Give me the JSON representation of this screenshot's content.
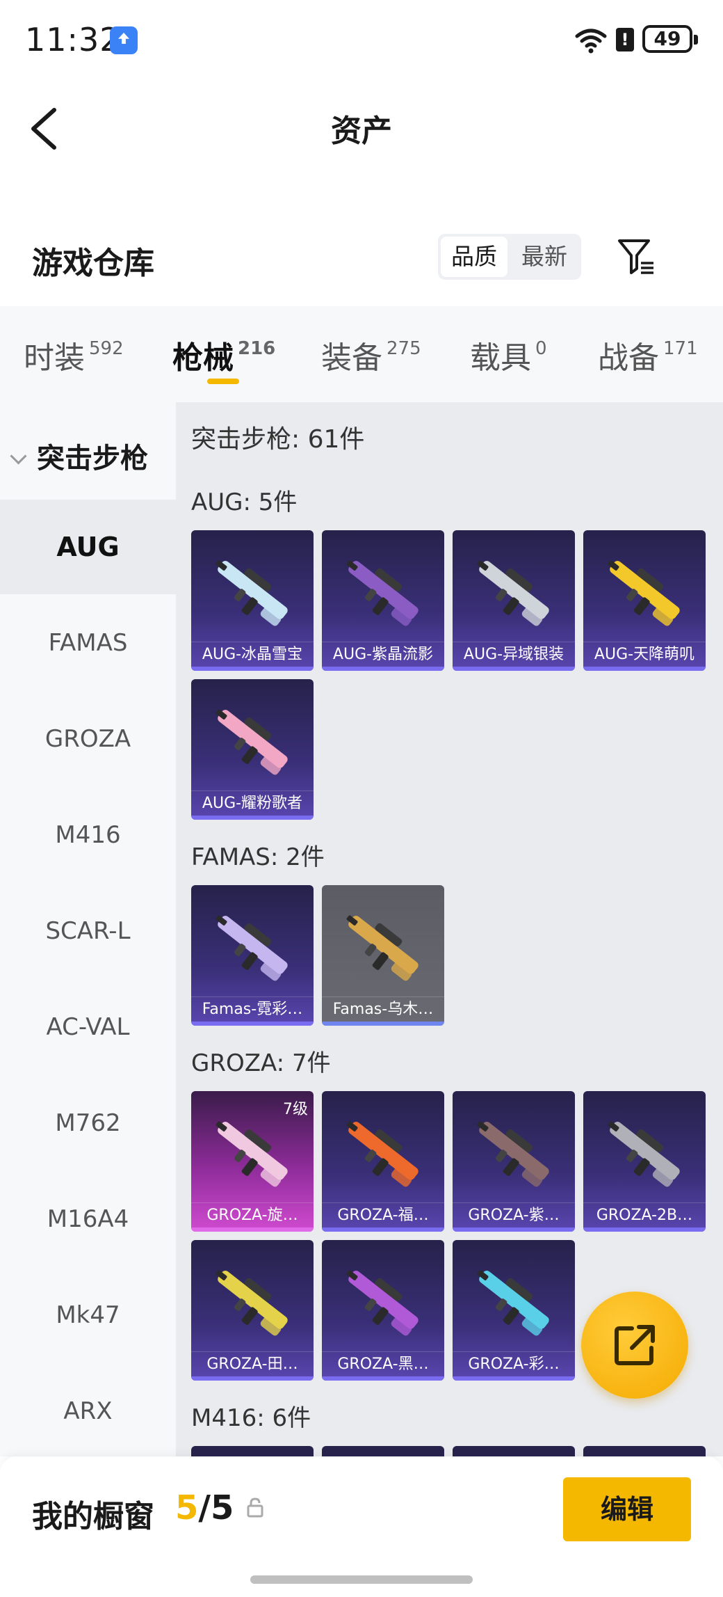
{
  "status_bar": {
    "time": "11:32",
    "battery": "49"
  },
  "header": {
    "title": "资产"
  },
  "warehouse": {
    "title": "游戏仓库",
    "sort_options": [
      "品质",
      "最新"
    ],
    "active_sort": "品质"
  },
  "tabs": [
    {
      "label": "时装",
      "count": "592"
    },
    {
      "label": "枪械",
      "count": "216",
      "active": true
    },
    {
      "label": "装备",
      "count": "275"
    },
    {
      "label": "载具",
      "count": "0"
    },
    {
      "label": "战备",
      "count": "171"
    }
  ],
  "sidebar": {
    "category": "突击步枪",
    "items": [
      "AUG",
      "FAMAS",
      "GROZA",
      "M416",
      "SCAR-L",
      "AC-VAL",
      "M762",
      "M16A4",
      "Mk47",
      "ARX"
    ],
    "active": "AUG"
  },
  "content": {
    "summary": "突击步枪: 61件",
    "sections": [
      {
        "title": "AUG: 5件",
        "items": [
          {
            "name": "AUG-冰晶雪宝",
            "color": "#c9e6f5"
          },
          {
            "name": "AUG-紫晶流影",
            "color": "#8a5cc4"
          },
          {
            "name": "AUG-异域银装",
            "color": "#cfd3da"
          },
          {
            "name": "AUG-天降萌叽",
            "color": "#f2c82a"
          },
          {
            "name": "AUG-耀粉歌者",
            "color": "#f2a7c4"
          }
        ]
      },
      {
        "title": "FAMAS: 2件",
        "items": [
          {
            "name": "Famas-霓彩…",
            "color": "#c6b6f0"
          },
          {
            "name": "Famas-乌木…",
            "color": "#d8a84a",
            "style": "grey"
          }
        ]
      },
      {
        "title": "GROZA: 7件",
        "items": [
          {
            "name": "GROZA-旋…",
            "color": "#f0c8e0",
            "style": "pink",
            "level": "7级"
          },
          {
            "name": "GROZA-福…",
            "color": "#ee6a2c"
          },
          {
            "name": "GROZA-紫…",
            "color": "#8a6a6a"
          },
          {
            "name": "GROZA-2B…",
            "color": "#b0b0b8"
          },
          {
            "name": "GROZA-田…",
            "color": "#e3d24a"
          },
          {
            "name": "GROZA-黑…",
            "color": "#b05ad8"
          },
          {
            "name": "GROZA-彩…",
            "color": "#5ad0e8"
          }
        ]
      },
      {
        "title": "M416: 6件",
        "items": [
          {
            "name": "",
            "color": "#8a8ab0"
          },
          {
            "name": "",
            "color": "#8a8ab0"
          },
          {
            "name": "",
            "color": "#8a8ab0"
          },
          {
            "name": "",
            "color": "#8a8ab0"
          }
        ]
      }
    ]
  },
  "bottom_bar": {
    "label": "我的橱窗",
    "count_current": "5",
    "count_total": "/5",
    "edit_label": "编辑"
  },
  "icons": {
    "back": "back-arrow-icon",
    "filter": "filter-icon",
    "fab": "share-external-icon",
    "lock": "lock-icon"
  }
}
